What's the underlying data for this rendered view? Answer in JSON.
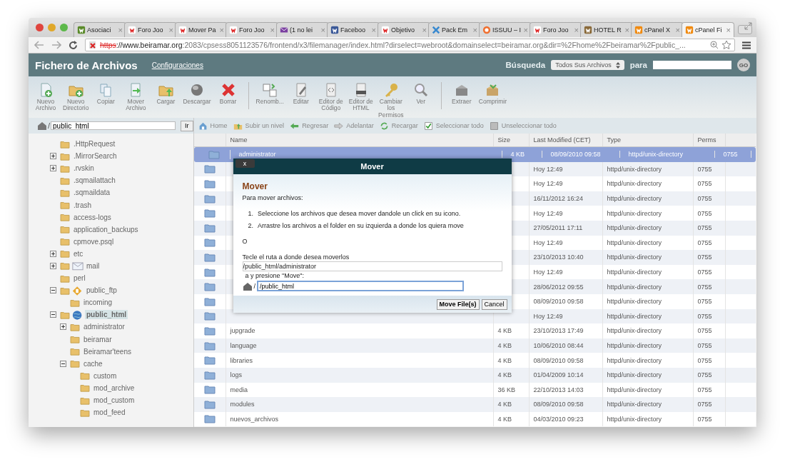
{
  "browser": {
    "tabs": [
      {
        "title": "Asociaci",
        "selected": false
      },
      {
        "title": "Foro Joo",
        "selected": false
      },
      {
        "title": "Mover Pa",
        "selected": false
      },
      {
        "title": "Foro Joo",
        "selected": false
      },
      {
        "title": "(1 no lei",
        "selected": false
      },
      {
        "title": "Faceboo",
        "selected": false
      },
      {
        "title": "Objetivo",
        "selected": false
      },
      {
        "title": "Pack Em",
        "selected": false
      },
      {
        "title": "ISSUU – I",
        "selected": false
      },
      {
        "title": "Foro Joo",
        "selected": false
      },
      {
        "title": "HOTEL R",
        "selected": false
      },
      {
        "title": "cPanel X",
        "selected": false
      },
      {
        "title": "cPanel Fi",
        "selected": true
      }
    ],
    "tab_close": "×",
    "url": {
      "scheme": "https",
      "host": "://www.beiramar.org",
      "rest": ":2083/cpsess8051123576/frontend/x3/filemanager/index.html?dirselect=webroot&domainselect=beiramar.org&dir=%2Fhome%2Fbeiramar%2Fpublic_..."
    }
  },
  "header": {
    "title": "Fichero de Archivos",
    "settings_link": "Configuraciones",
    "search_label": "Búsqueda",
    "search_scope": "Todos Sus Archivos",
    "for_label": "para",
    "go": "GO"
  },
  "toolbar": [
    [
      "Nuevo\nArchivo",
      "Nuevo\nDirectorio",
      "Copiar",
      "Mover\nArchivo",
      "Cargar",
      "Descargar",
      "Borrar"
    ],
    [
      "Renomb...",
      "Editar",
      "Editor de\nCódigo",
      "Editor de\nHTML",
      "Cambiar\nlos\nPermisos",
      "Ver"
    ],
    [
      "Extraer",
      "Comprimir"
    ]
  ],
  "path": {
    "separator": "/",
    "value": "public_html",
    "go": "Ir"
  },
  "nav": [
    "Home",
    "Subir un nivel",
    "Regresar",
    "Adelantar",
    "Recargar",
    "Seleccionar todo",
    "Unseleccionar todo"
  ],
  "tree": [
    {
      "name": ".HttpRequest",
      "kind": "folder"
    },
    {
      "name": ".MirrorSearch",
      "kind": "folder",
      "expanded": false
    },
    {
      "name": ".rvskin",
      "kind": "folder",
      "expanded": false
    },
    {
      "name": ".sqmailattach",
      "kind": "folder"
    },
    {
      "name": ".sqmaildata",
      "kind": "folder"
    },
    {
      "name": ".trash",
      "kind": "folder"
    },
    {
      "name": "access-logs",
      "kind": "folder"
    },
    {
      "name": "application_backups",
      "kind": "folder"
    },
    {
      "name": "cpmove.psql",
      "kind": "folder"
    },
    {
      "name": "etc",
      "kind": "folder",
      "expanded": false
    },
    {
      "name": "mail",
      "kind": "mail",
      "expanded": false
    },
    {
      "name": "perl",
      "kind": "folder"
    },
    {
      "name": "public_ftp",
      "kind": "ftp",
      "expanded": true,
      "children": [
        {
          "name": "incoming",
          "kind": "folder"
        }
      ]
    },
    {
      "name": "public_html",
      "kind": "web",
      "expanded": true,
      "selected": true,
      "children": [
        {
          "name": "administrator",
          "kind": "folder",
          "expanded": false
        },
        {
          "name": "beiramar",
          "kind": "folder"
        },
        {
          "name": "Beiramar'teens",
          "kind": "folder"
        },
        {
          "name": "cache",
          "kind": "folder",
          "expanded": true,
          "children": [
            {
              "name": "custom",
              "kind": "folder"
            },
            {
              "name": "mod_archive",
              "kind": "folder"
            },
            {
              "name": "mod_custom",
              "kind": "folder"
            },
            {
              "name": "mod_feed",
              "kind": "folder"
            }
          ]
        }
      ]
    }
  ],
  "table": {
    "columns": [
      "Name",
      "Size",
      "Last Modified (CET)",
      "Type",
      "Perms"
    ],
    "rows": [
      {
        "name": "administrator",
        "size": "4 KB",
        "modified": "08/09/2010 09:58",
        "type": "httpd/unix-directory",
        "perms": "0755",
        "selected": true
      },
      {
        "modified": "Hoy 12:49",
        "type": "httpd/unix-directory",
        "perms": "0755",
        "selected": false
      },
      {
        "modified": "Hoy 12:49",
        "type": "httpd/unix-directory",
        "perms": "0755",
        "selected": false
      },
      {
        "modified": "16/11/2012 16:24",
        "type": "httpd/unix-directory",
        "perms": "0755",
        "selected": false
      },
      {
        "modified": "Hoy 12:49",
        "type": "httpd/unix-directory",
        "perms": "0755",
        "selected": false
      },
      {
        "modified": "27/05/2011 17:11",
        "type": "httpd/unix-directory",
        "perms": "0755",
        "selected": false
      },
      {
        "modified": "Hoy 12:49",
        "type": "httpd/unix-directory",
        "perms": "0755",
        "selected": false
      },
      {
        "modified": "23/10/2013 10:40",
        "type": "httpd/unix-directory",
        "perms": "0755",
        "selected": false
      },
      {
        "modified": "Hoy 12:49",
        "type": "httpd/unix-directory",
        "perms": "0755",
        "selected": false
      },
      {
        "modified": "28/06/2012 09:55",
        "type": "httpd/unix-directory",
        "perms": "0755",
        "selected": false
      },
      {
        "modified": "08/09/2010 09:58",
        "type": "httpd/unix-directory",
        "perms": "0755",
        "selected": false
      },
      {
        "modified": "Hoy 12:49",
        "type": "httpd/unix-directory",
        "perms": "0755",
        "selected": false
      },
      {
        "name": "jupgrade",
        "size": "4 KB",
        "modified": "23/10/2013 17:49",
        "type": "httpd/unix-directory",
        "perms": "0755",
        "selected": false
      },
      {
        "name": "language",
        "size": "4 KB",
        "modified": "10/06/2010 08:44",
        "type": "httpd/unix-directory",
        "perms": "0755",
        "selected": false
      },
      {
        "name": "libraries",
        "size": "4 KB",
        "modified": "08/09/2010 09:58",
        "type": "httpd/unix-directory",
        "perms": "0755",
        "selected": false
      },
      {
        "name": "logs",
        "size": "4 KB",
        "modified": "01/04/2009 10:14",
        "type": "httpd/unix-directory",
        "perms": "0755",
        "selected": false
      },
      {
        "name": "media",
        "size": "36 KB",
        "modified": "22/10/2013 14:03",
        "type": "httpd/unix-directory",
        "perms": "0755",
        "selected": false
      },
      {
        "name": "modules",
        "size": "4 KB",
        "modified": "08/09/2010 09:58",
        "type": "httpd/unix-directory",
        "perms": "0755",
        "selected": false
      },
      {
        "name": "nuevos_archivos",
        "size": "4 KB",
        "modified": "04/03/2010 09:23",
        "type": "httpd/unix-directory",
        "perms": "0755",
        "selected": false
      }
    ]
  },
  "dialog": {
    "close": "x",
    "title": "Mover",
    "heading": "Mover",
    "intro": "Para mover archivos:",
    "steps": [
      {
        "number": "1.",
        "text": "Seleccione los archivos que desea mover dandole un click en su icono."
      },
      {
        "number": "2.",
        "text": "Arrastre los archivos a el folder en su izquierda a donde los quiera move"
      }
    ],
    "or": "O",
    "prompt": "Tecle el ruta a donde desea moverlos",
    "source": "/public_html/administrator",
    "press": "a y presione \"Move\":",
    "separator": "/",
    "destination": "/public_html",
    "buttons": [
      "Move File(s)",
      "Cancel"
    ]
  }
}
